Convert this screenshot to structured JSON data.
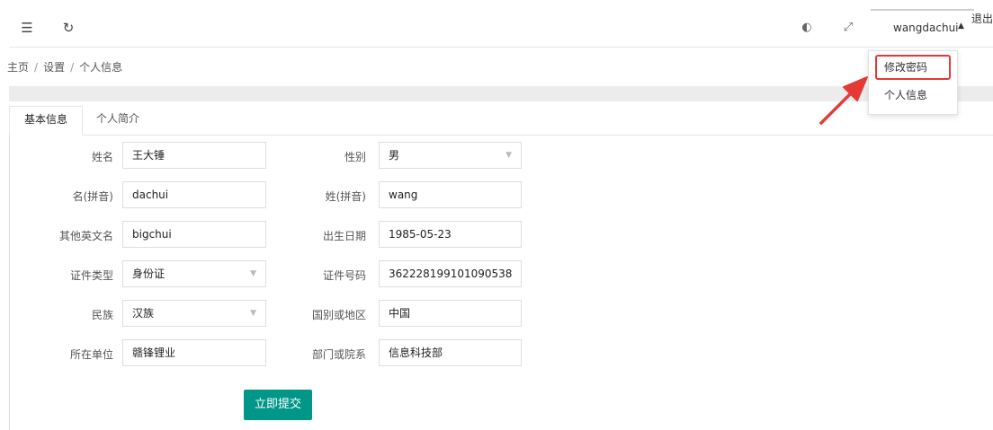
{
  "header": {
    "menu_icon": "menu-fold-icon",
    "refresh_icon": "refresh-icon",
    "theme_icon": "palette-icon",
    "fullscreen_icon": "fullscreen-icon",
    "username": "wangdachui",
    "logout": "退出"
  },
  "user_menu": {
    "items": [
      "修改密码",
      "个人信息"
    ],
    "highlight_color": "#e53935"
  },
  "breadcrumb": [
    "主页",
    "设置",
    "个人信息"
  ],
  "tabs": [
    "基本信息",
    "个人简介"
  ],
  "form": {
    "left": [
      {
        "label": "姓名",
        "value": "王大锤"
      },
      {
        "label": "名(拼音)",
        "value": "dachui"
      },
      {
        "label": "其他英文名",
        "value": "bigchui"
      },
      {
        "label": "证件类型",
        "value": "身份证"
      },
      {
        "label": "民族",
        "value": "汉族"
      },
      {
        "label": "所在单位",
        "value": "赣锋锂业"
      }
    ],
    "right": [
      {
        "label": "性别",
        "value": "男"
      },
      {
        "label": "姓(拼音)",
        "value": "wang"
      },
      {
        "label": "出生日期",
        "value": "1985-05-23"
      },
      {
        "label": "证件号码",
        "value": "362228199101090538"
      },
      {
        "label": "国别或地区",
        "value": "中国"
      },
      {
        "label": "部门或院系",
        "value": "信息科技部"
      }
    ],
    "submit": "立即提交",
    "accent_color": "#009688"
  }
}
